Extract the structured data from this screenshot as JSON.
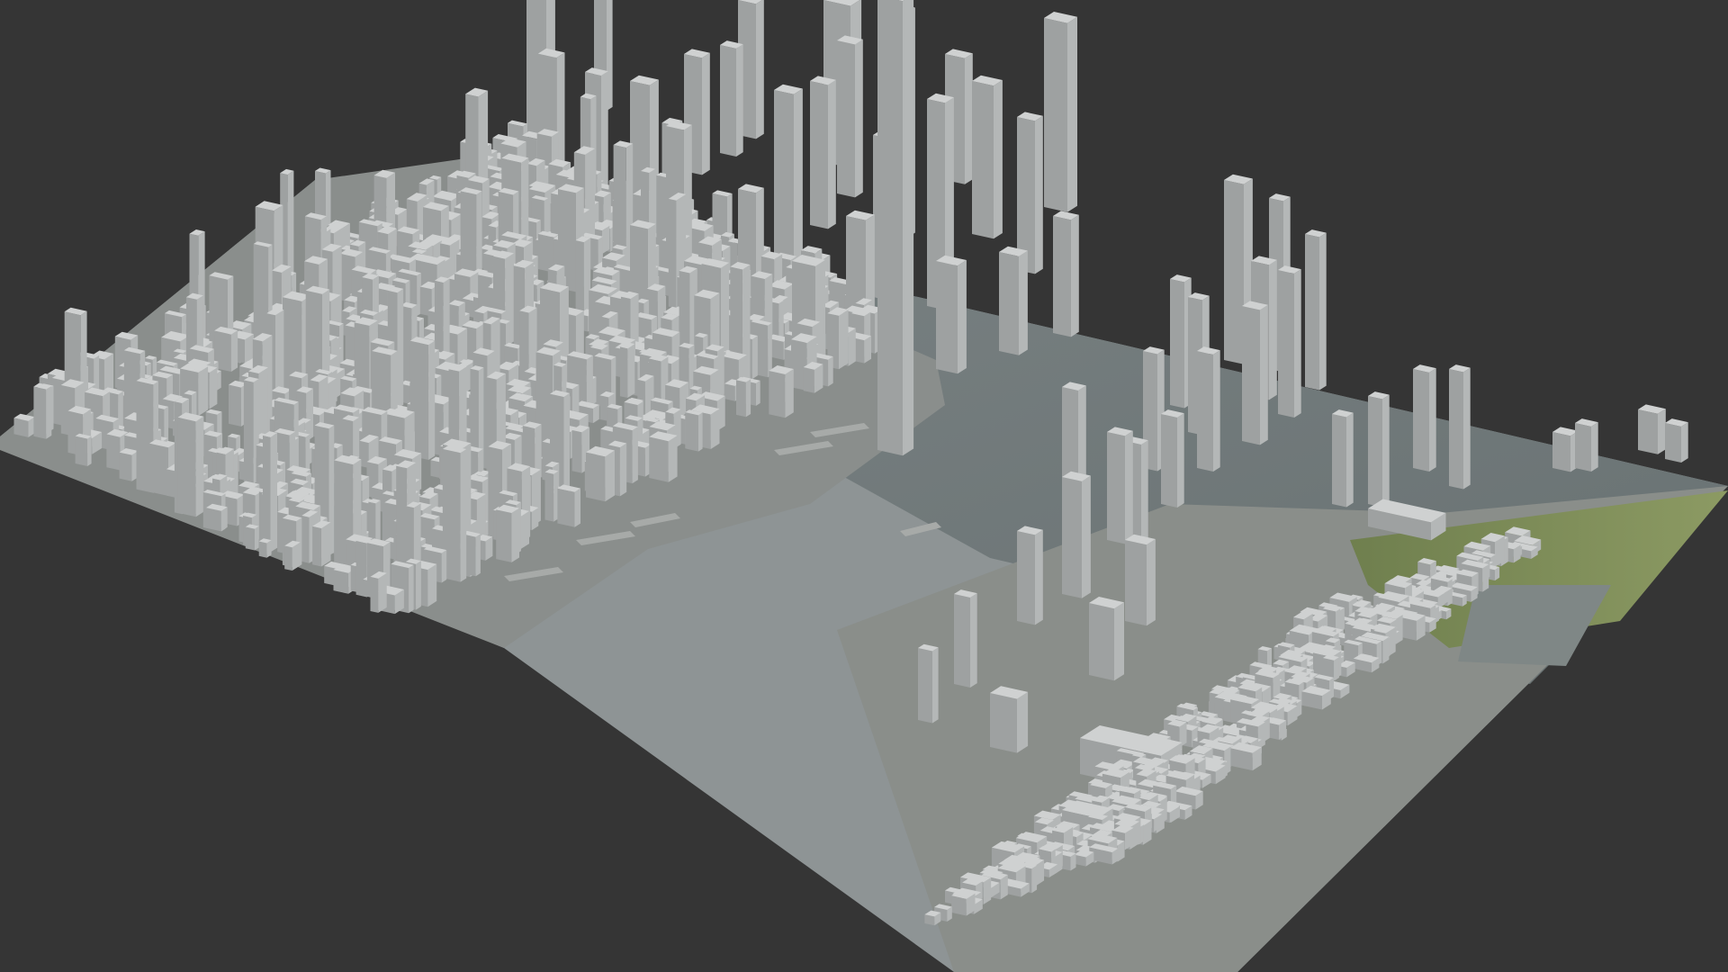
{
  "viewport": {
    "background_color": "#353535",
    "content": "3d-city-block-model",
    "colors": {
      "terrain": "#8d9395",
      "water": "#6e7778",
      "building_top": "#cfd1d1",
      "building_left": "#9ea1a1",
      "building_right": "#b4b7b7",
      "park": "#7a8a5a",
      "pier": "#a7aaa8"
    }
  }
}
